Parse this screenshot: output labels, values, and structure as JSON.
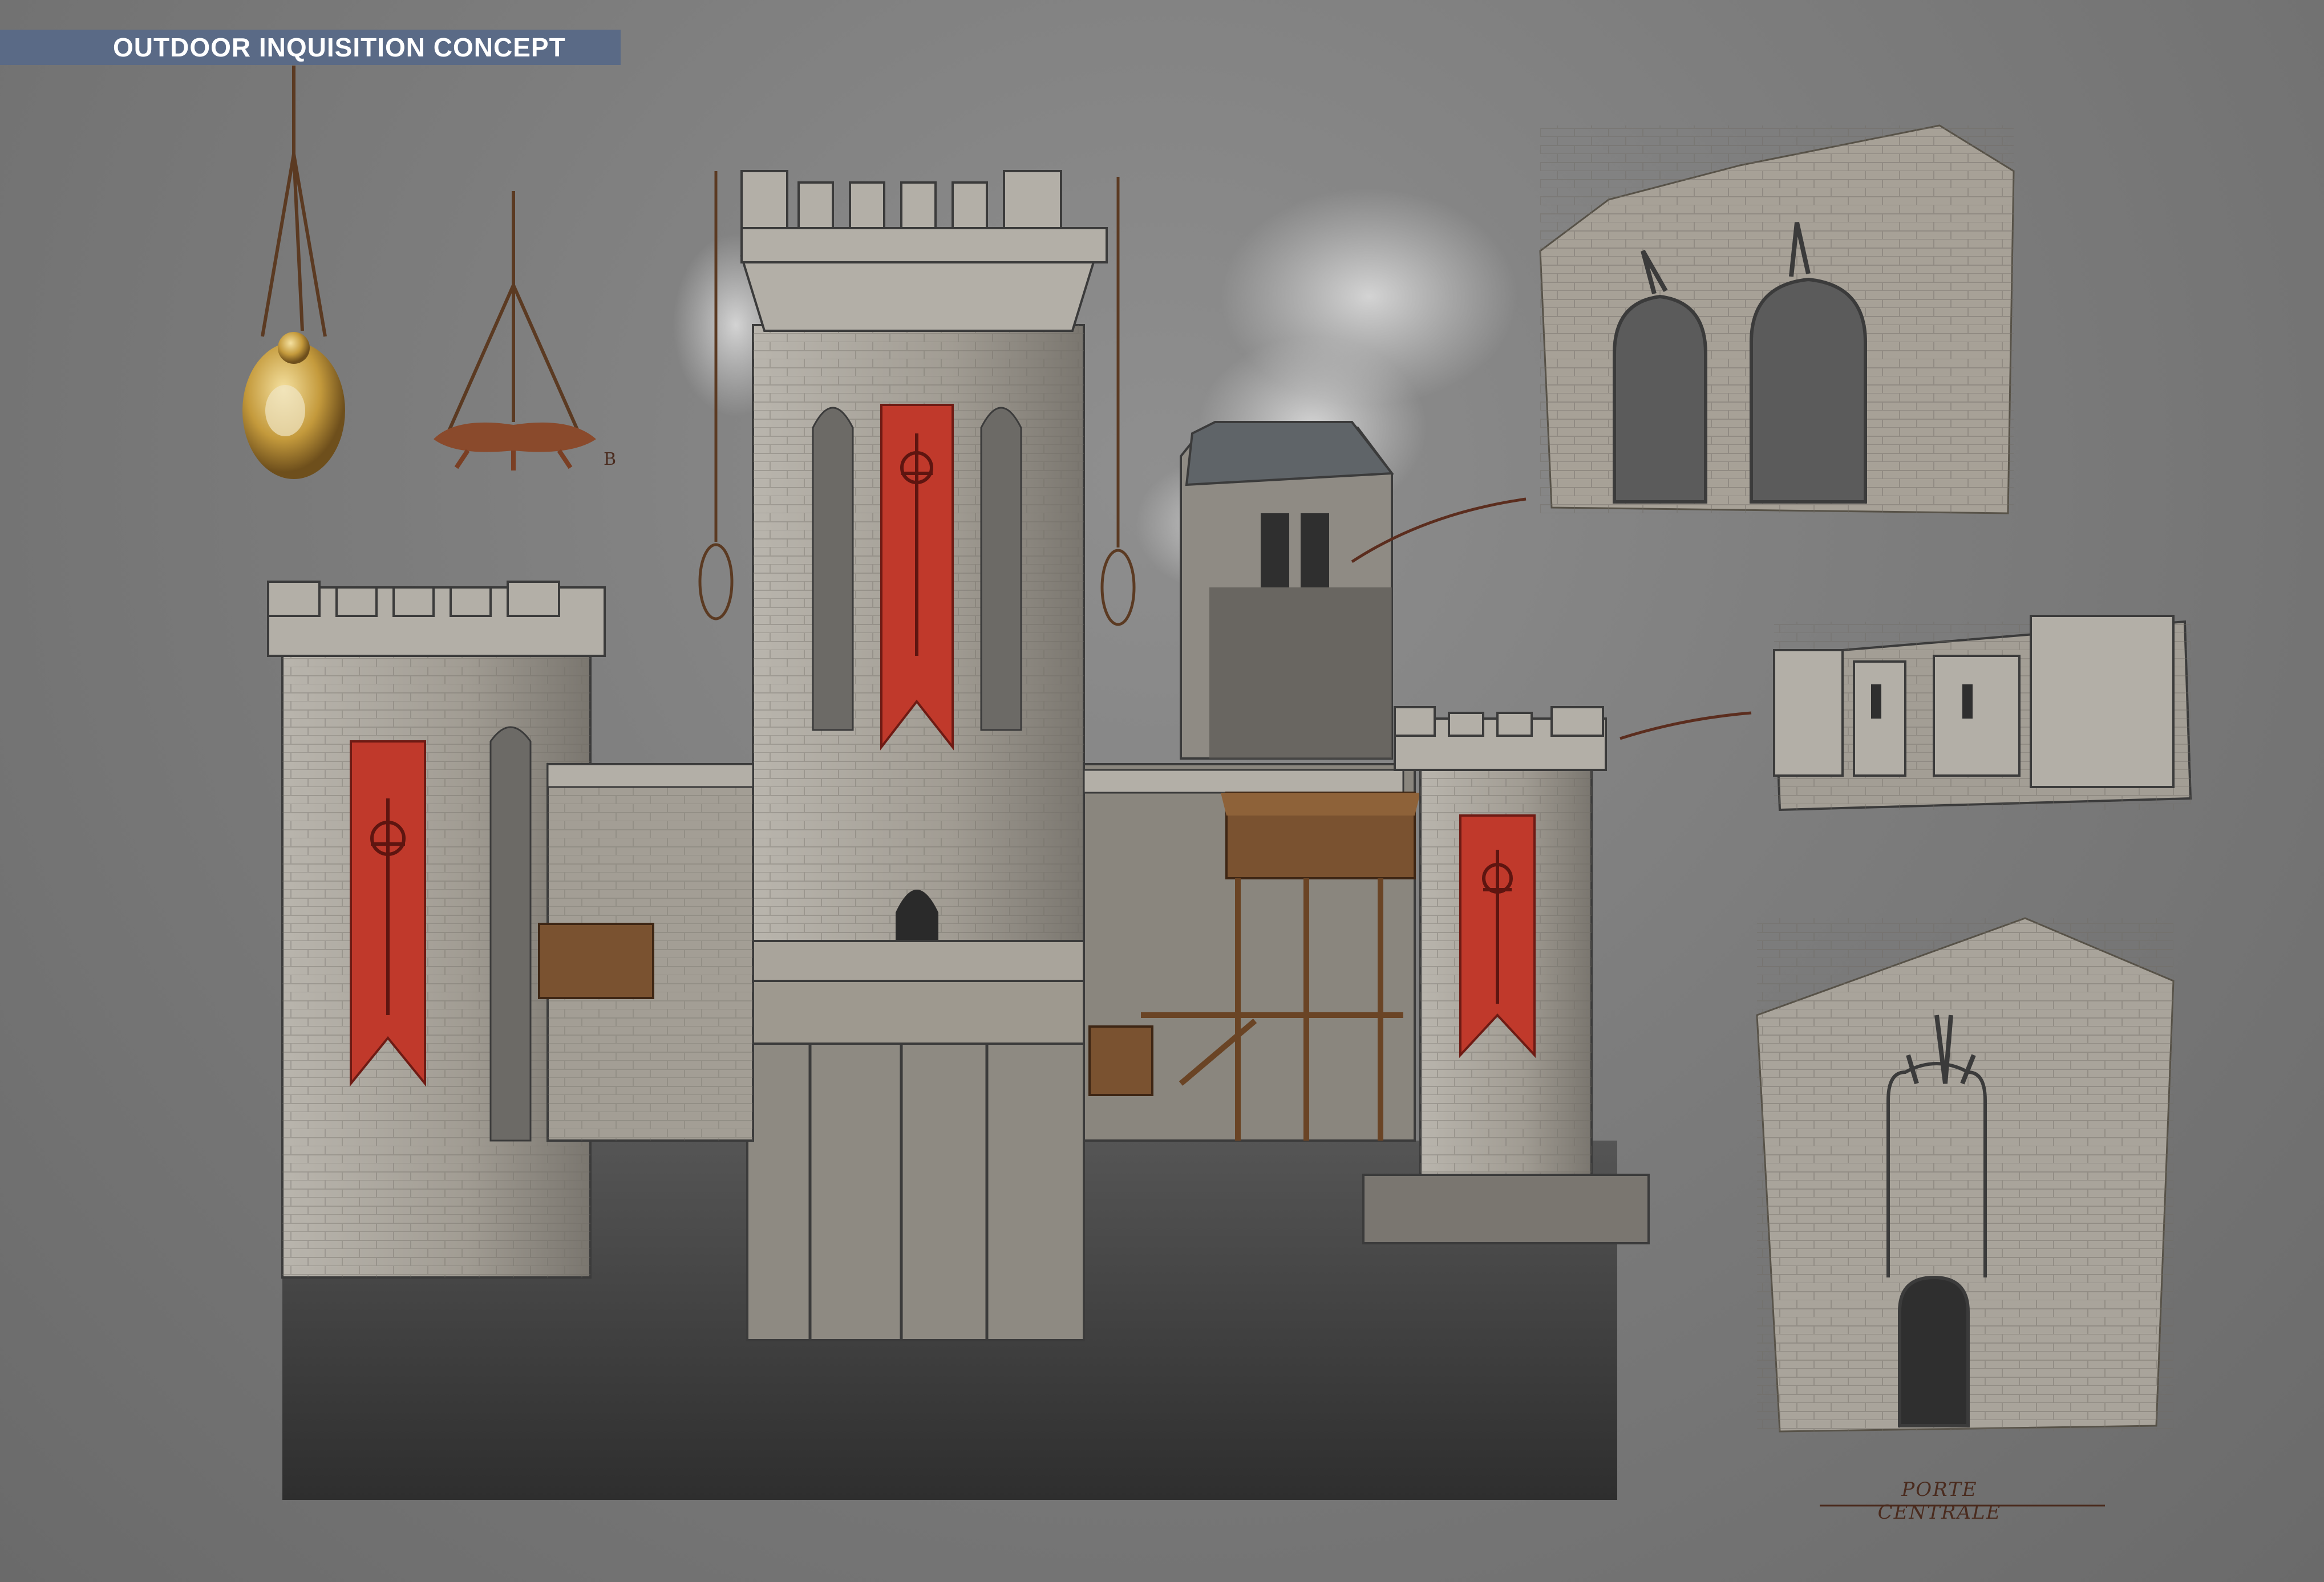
{
  "header": {
    "title": "OUTDOOR INQUISITION CONCEPT"
  },
  "sketches": {
    "lamp_initial": "B",
    "gate_caption": "PORTE CENTRALE"
  },
  "colors": {
    "header_bar": "#5a6a86",
    "banner_red": "#c0392b",
    "stone": "#a9a49b",
    "wood": "#7a5230",
    "background": "#7d7d7d"
  }
}
